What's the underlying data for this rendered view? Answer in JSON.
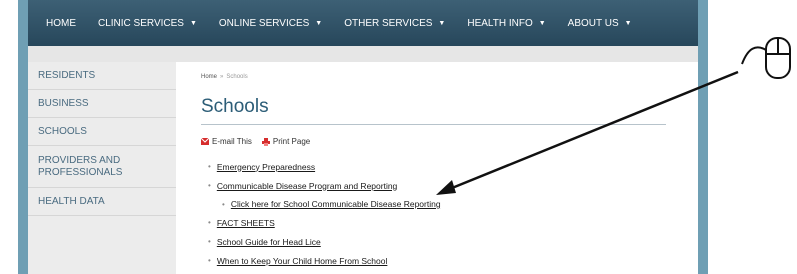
{
  "nav": {
    "items": [
      {
        "label": "HOME",
        "caret": false
      },
      {
        "label": "CLINIC SERVICES",
        "caret": true
      },
      {
        "label": "ONLINE SERVICES",
        "caret": true
      },
      {
        "label": "OTHER SERVICES",
        "caret": true
      },
      {
        "label": "HEALTH INFO",
        "caret": true
      },
      {
        "label": "ABOUT US",
        "caret": true
      }
    ],
    "caret_glyph": "▼"
  },
  "sidebar": {
    "items": [
      {
        "label": "RESIDENTS"
      },
      {
        "label": "BUSINESS"
      },
      {
        "label": "SCHOOLS"
      },
      {
        "label": "PROVIDERS AND PROFESSIONALS"
      },
      {
        "label": "HEALTH DATA"
      }
    ]
  },
  "breadcrumb": {
    "home": "Home",
    "separator": "»",
    "current": "Schools"
  },
  "page": {
    "title": "Schools"
  },
  "tools": {
    "email_label": "E-mail This",
    "print_label": "Print Page"
  },
  "links": [
    {
      "label": "Emergency Preparedness",
      "sub": false
    },
    {
      "label": "Communicable Disease Program and Reporting",
      "sub": false
    },
    {
      "label": "Click here for School Communicable Disease Reporting",
      "sub": true
    },
    {
      "label": "FACT SHEETS",
      "sub": false
    },
    {
      "label": "School Guide for Head Lice",
      "sub": false
    },
    {
      "label": "When to Keep Your Child Home From School",
      "sub": false
    }
  ],
  "bullet_glyph": "•",
  "annotation": {
    "icon": "mouse-icon",
    "arrow": "arrow-to-school-reporting-link"
  },
  "colors": {
    "nav_bg": "#2f5166",
    "frame": "#6f9fb4",
    "title": "#2c5d77",
    "icon_red": "#d62d2d"
  }
}
